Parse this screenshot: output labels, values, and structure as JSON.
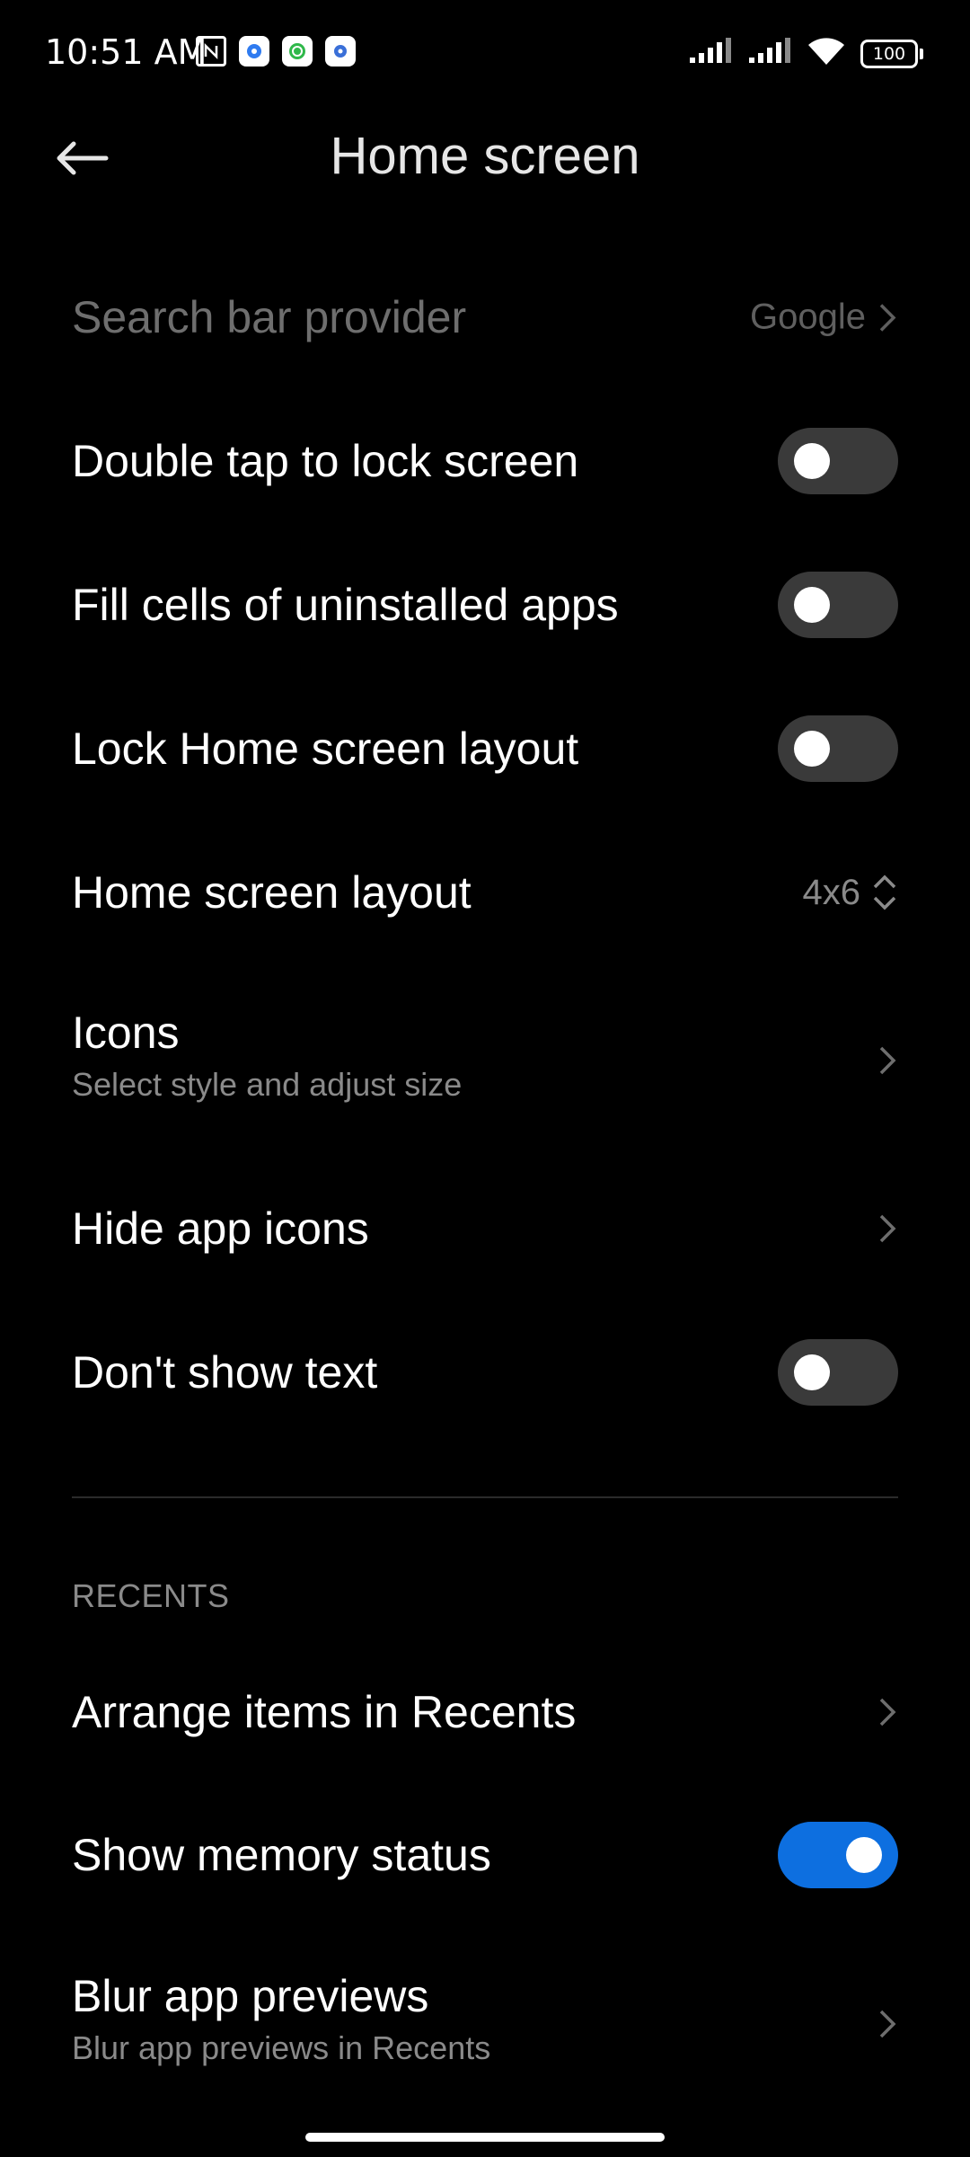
{
  "status_bar": {
    "time": "10:51 AM",
    "battery": "100",
    "notification_icons": [
      "nfc-icon",
      "settings-gear-icon",
      "circle-app-icon",
      "settings-gear-icon"
    ]
  },
  "header": {
    "title": "Home screen"
  },
  "items": [
    {
      "label": "Search bar provider",
      "value": "Google",
      "type": "link",
      "disabled": true
    },
    {
      "label": "Double tap to lock screen",
      "type": "toggle",
      "state": "off"
    },
    {
      "label": "Fill cells of uninstalled apps",
      "type": "toggle",
      "state": "off"
    },
    {
      "label": "Lock Home screen layout",
      "type": "toggle",
      "state": "off"
    },
    {
      "label": "Home screen layout",
      "value": "4x6",
      "type": "picker"
    },
    {
      "label": "Icons",
      "sublabel": "Select style and adjust size",
      "type": "link"
    },
    {
      "label": "Hide app icons",
      "type": "link"
    },
    {
      "label": "Don't show text",
      "type": "toggle",
      "state": "off"
    }
  ],
  "recents_section": {
    "header": "RECENTS",
    "items": [
      {
        "label": "Arrange items in Recents",
        "type": "link"
      },
      {
        "label": "Show memory status",
        "type": "toggle",
        "state": "on"
      },
      {
        "label": "Blur app previews",
        "sublabel": "Blur app previews in Recents",
        "type": "link"
      }
    ]
  },
  "colors": {
    "background": "#000000",
    "accent": "#0d6fe0",
    "toggle_off": "#3a3a3a",
    "secondary_text": "#8a8a8a"
  }
}
